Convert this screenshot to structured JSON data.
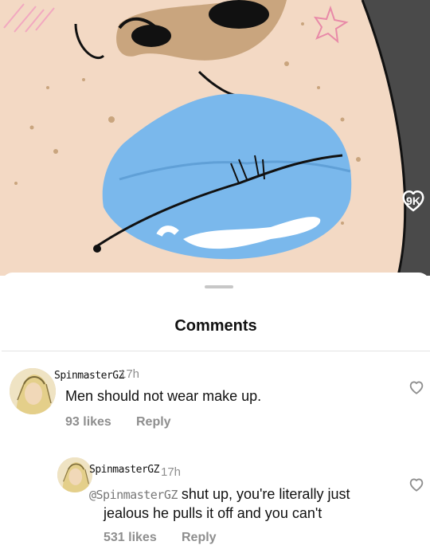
{
  "post": {
    "like_count": "9K",
    "like_icon": "heart-outline-icon"
  },
  "sheet": {
    "title": "Comments"
  },
  "comments": [
    {
      "username": "SpinmasterGZ",
      "time": "17h",
      "text": "Men should not wear make up.",
      "likes": "93 likes",
      "reply": "Reply"
    },
    {
      "username": "SpinmasterGZ",
      "time": "17h",
      "mention": "SpinmasterGZ",
      "text_line1": "shut up, you're literally just",
      "text_line2": "jealous he pulls it off and you can't",
      "likes": "531 likes",
      "reply": "Reply"
    }
  ],
  "colors": {
    "lips": "#7ab8ec",
    "skin": "#f3d9c4",
    "freckle": "#c9a57e",
    "secondary_text": "#8e8e8e"
  }
}
